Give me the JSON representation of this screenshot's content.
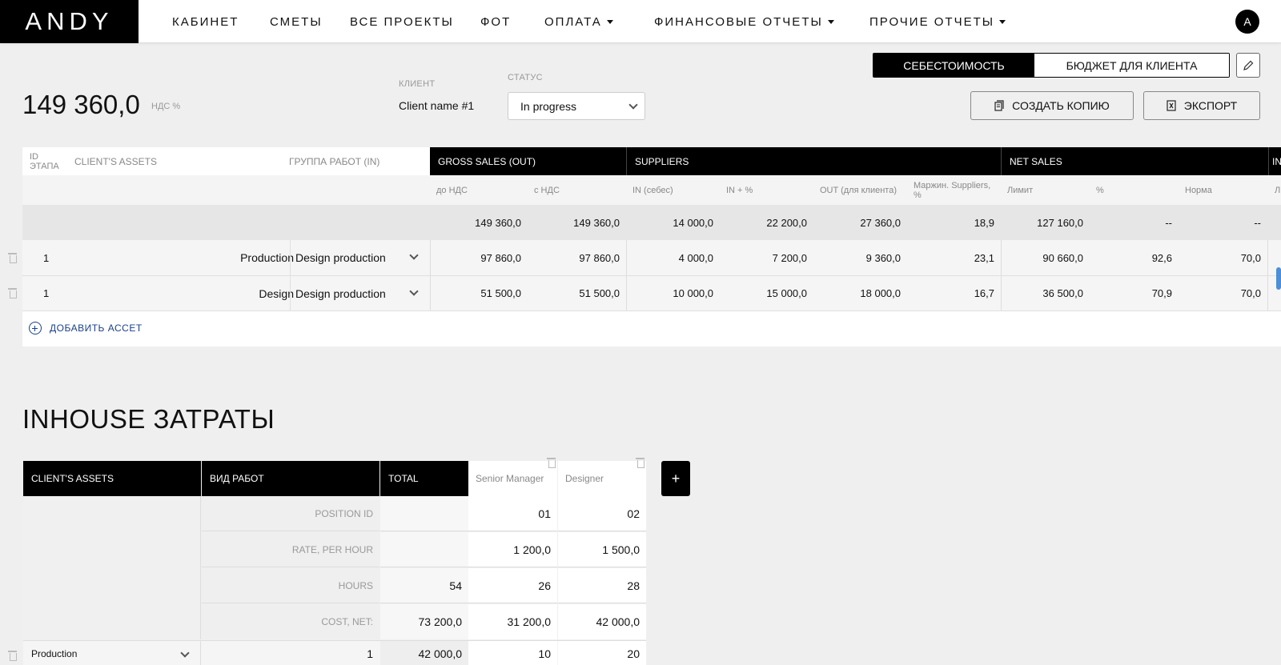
{
  "nav": {
    "logo": "ANDY",
    "items": [
      "КАБИНЕТ",
      "СМЕТЫ",
      "ВСЕ ПРОЕКТЫ",
      "ФОТ",
      "ОПЛАТА",
      "ФИНАНСОВЫЕ ОТЧЕТЫ",
      "ПРОЧИЕ ОТЧЕТЫ"
    ],
    "avatar": "A"
  },
  "header": {
    "total": "149 360,0",
    "vat_label": "НДС %",
    "client_label": "КЛИЕНТ",
    "client_name": "Client name #1",
    "status_label": "СТАТУС",
    "status_value": "In progress",
    "seg_active": "СЕБЕСТОИМОСТЬ",
    "seg_inactive": "БЮДЖЕТ ДЛЯ КЛИЕНТА",
    "copy_btn": "СОЗДАТЬ КОПИЮ",
    "export_btn": "ЭКСПОРТ"
  },
  "table": {
    "h_id": "ID ЭТАПА",
    "h_assets": "CLIENT'S ASSETS",
    "h_group": "ГРУППА РАБОТ (IN)",
    "h_gross": "GROSS SALES (OUT)",
    "h_suppliers": "SUPPLIERS",
    "h_net": "NET SALES",
    "h_in": "IN",
    "sub": [
      "до НДС",
      "с НДС",
      "IN (себес)",
      "IN + %",
      "OUT (для клиента)",
      "Маржин. Suppliers, %",
      "Лимит",
      "%",
      "Норма",
      "Л"
    ],
    "totals": [
      "149 360,0",
      "149 360,0",
      "14 000,0",
      "22 200,0",
      "27 360,0",
      "18,9",
      "127 160,0",
      "--",
      "--"
    ],
    "rows": [
      {
        "id": "1",
        "asset": "Production",
        "group": "Design production",
        "vals": [
          "97 860,0",
          "97 860,0",
          "4 000,0",
          "7 200,0",
          "9 360,0",
          "23,1",
          "90 660,0",
          "92,6",
          "70,0"
        ]
      },
      {
        "id": "1",
        "asset": "Design",
        "group": "Design production",
        "vals": [
          "51 500,0",
          "51 500,0",
          "10 000,0",
          "15 000,0",
          "18 000,0",
          "16,7",
          "36 500,0",
          "70,9",
          "70,0"
        ]
      }
    ],
    "add_asset": "ДОБАВИТЬ АССЕТ"
  },
  "inhouse": {
    "title": "INHOUSE ЗАТРАТЫ",
    "h_assets": "CLIENT'S ASSETS",
    "h_work": "ВИД РАБОТ",
    "h_total": "TOTAL",
    "h_pos1": "Senior Manager",
    "h_pos2": "Designer",
    "plus": "+",
    "rows": [
      {
        "label": "POSITION ID",
        "total": "",
        "p1": "01",
        "p2": "02"
      },
      {
        "label": "RATE, PER HOUR",
        "total": "",
        "p1": "1 200,0",
        "p2": "1 500,0"
      },
      {
        "label": "HOURS",
        "total": "54",
        "p1": "26",
        "p2": "28"
      },
      {
        "label": "COST, NET:",
        "total": "73 200,0",
        "p1": "31 200,0",
        "p2": "42 000,0"
      }
    ],
    "last_row": {
      "asset": "Production",
      "work": "1",
      "total": "42 000,0",
      "p1": "10",
      "p2": "20"
    }
  }
}
